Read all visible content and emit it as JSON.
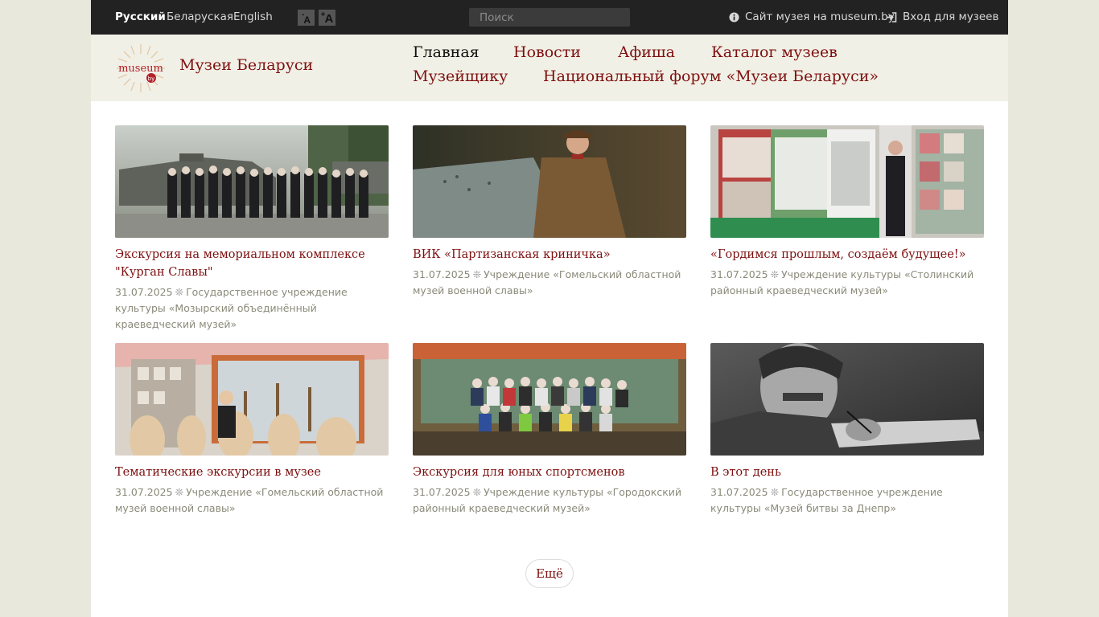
{
  "topbar": {
    "languages": [
      {
        "label": "Русский",
        "active": true
      },
      {
        "label": "Беларуская",
        "active": false
      },
      {
        "label": "English",
        "active": false
      }
    ],
    "font_decrease": "A",
    "font_increase": "A",
    "search_placeholder": "Поиск",
    "site_link": "Сайт музея на museum.by",
    "login_link": "Вход для музеев"
  },
  "header": {
    "site_title": "Музеи Беларуси",
    "nav": [
      {
        "label": "Главная",
        "active": true
      },
      {
        "label": "Новости",
        "active": false
      },
      {
        "label": "Афиша",
        "active": false
      },
      {
        "label": "Каталог музеев",
        "active": false
      },
      {
        "label": "Музейщику",
        "active": false
      },
      {
        "label": "Национальный форум «Музеи Беларуси»",
        "active": false
      }
    ]
  },
  "news": [
    {
      "title": "Экскурсия на мемориальном комплексе \"Курган Славы\"",
      "date": "31.07.2025",
      "source": "Государственное учреждение культуры «Мозырский объединённый краеведческий музей»"
    },
    {
      "title": "ВИК «Партизанская криничка»",
      "date": "31.07.2025",
      "source": "Учреждение «Гомельский областной музей военной славы»"
    },
    {
      "title": "«Гордимся прошлым, создаём будущее!»",
      "date": "31.07.2025",
      "source": "Учреждение культуры «Столинский районный краеведческий музей»"
    },
    {
      "title": "Тематические экскурсии в музее",
      "date": "31.07.2025",
      "source": "Учреждение «Гомельский областной музей военной славы»"
    },
    {
      "title": "Экскурсия для юных спортсменов",
      "date": "31.07.2025",
      "source": "Учреждение культуры «Городокский районный краеведческий музей»"
    },
    {
      "title": "В этот день",
      "date": "31.07.2025",
      "source": "Государственное учреждение культуры «Музей битвы за Днепр»"
    }
  ],
  "more_label": "Ещё",
  "colors": {
    "accent": "#7e1010",
    "topbar": "#222222",
    "header": "#f1f0e6"
  }
}
